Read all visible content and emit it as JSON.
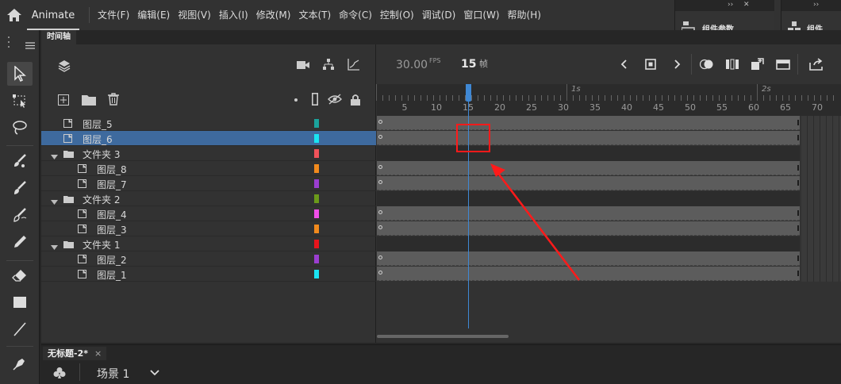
{
  "app": {
    "name": "Animate"
  },
  "menu": [
    "文件(F)",
    "编辑(E)",
    "视图(V)",
    "插入(I)",
    "修改(M)",
    "文本(T)",
    "命令(C)",
    "控制(O)",
    "调试(D)",
    "窗口(W)",
    "帮助(H)"
  ],
  "docked_panels": [
    {
      "label": "组件参数",
      "icon": "component-params-icon"
    },
    {
      "label": "组件",
      "icon": "components-icon"
    }
  ],
  "panel_tab": "时间轴",
  "timeline": {
    "fps_value": "30.00",
    "fps_unit": "FPS",
    "current_frame": "15",
    "frame_unit": "帧",
    "ruler_numbers": [
      "5",
      "10",
      "15",
      "20",
      "25",
      "30",
      "35",
      "40",
      "45",
      "50",
      "55",
      "60",
      "65",
      "70"
    ],
    "ruler_seconds": [
      "1s",
      "2s"
    ]
  },
  "layers": [
    {
      "name": "图层_5",
      "type": "layer",
      "indent": 0,
      "color": "#1ba39c",
      "selected": false
    },
    {
      "name": "图层_6",
      "type": "layer",
      "indent": 0,
      "color": "#1ae4f2",
      "selected": true
    },
    {
      "name": "文件夹 3",
      "type": "folder",
      "indent": 0,
      "color": "#f0525a",
      "selected": false
    },
    {
      "name": "图层_8",
      "type": "layer",
      "indent": 1,
      "color": "#f18a1d",
      "selected": false
    },
    {
      "name": "图层_7",
      "type": "layer",
      "indent": 1,
      "color": "#9b3ed0",
      "selected": false
    },
    {
      "name": "文件夹 2",
      "type": "folder",
      "indent": 0,
      "color": "#6b9a1a",
      "selected": false
    },
    {
      "name": "图层_4",
      "type": "layer",
      "indent": 1,
      "color": "#f04ee8",
      "selected": false
    },
    {
      "name": "图层_3",
      "type": "layer",
      "indent": 1,
      "color": "#f18a1d",
      "selected": false
    },
    {
      "name": "文件夹 1",
      "type": "folder",
      "indent": 0,
      "color": "#e8141c",
      "selected": false
    },
    {
      "name": "图层_2",
      "type": "layer",
      "indent": 1,
      "color": "#9b3ed0",
      "selected": false
    },
    {
      "name": "图层_1",
      "type": "layer",
      "indent": 1,
      "color": "#1ae4f2",
      "selected": false
    }
  ],
  "document": {
    "tab": "无标题-2*",
    "close": "×",
    "scene": "场景 1"
  },
  "colors": {
    "accent": "#3f88d4",
    "annotation": "#ff1a1a",
    "selection": "#3e6a9e"
  }
}
